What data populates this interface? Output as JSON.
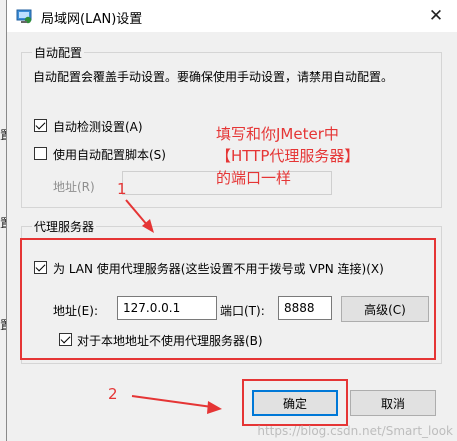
{
  "window": {
    "title": "局域网(LAN)设置",
    "close_symbol": "✕",
    "background_fragments": [
      "置",
      "置",
      "置"
    ]
  },
  "auto_config": {
    "group_label": "自动配置",
    "description": "自动配置会覆盖手动设置。要确保使用手动设置，请禁用自动配置。",
    "auto_detect": {
      "label": "自动检测设置(A)",
      "checked": true
    },
    "use_script": {
      "label": "使用自动配置脚本(S)",
      "checked": false
    },
    "address_label": "地址(R)",
    "address_value": ""
  },
  "proxy": {
    "group_label": "代理服务器",
    "use_proxy": {
      "label": "为 LAN 使用代理服务器(这些设置不用于拨号或 VPN 连接)(X)",
      "checked": true
    },
    "address_label": "地址(E):",
    "address_value": "127.0.0.1",
    "port_label": "端口(T):",
    "port_value": "8888",
    "advanced_button": "高级(C)",
    "bypass_local": {
      "label": "对于本地地址不使用代理服务器(B)",
      "checked": true
    }
  },
  "buttons": {
    "ok": "确定",
    "cancel": "取消"
  },
  "annotations": {
    "note_lines": [
      "填写和你JMeter中",
      "【HTTP代理服务器】",
      "的端口一样"
    ],
    "step1": "1",
    "step2": "2",
    "color": "#e53535"
  },
  "watermark": "https://blog.csdn.net/Smart_look",
  "colors": {
    "dialog_bg": "#f0f0f0",
    "accent": "#0078d7",
    "annotation": "#e53535"
  }
}
